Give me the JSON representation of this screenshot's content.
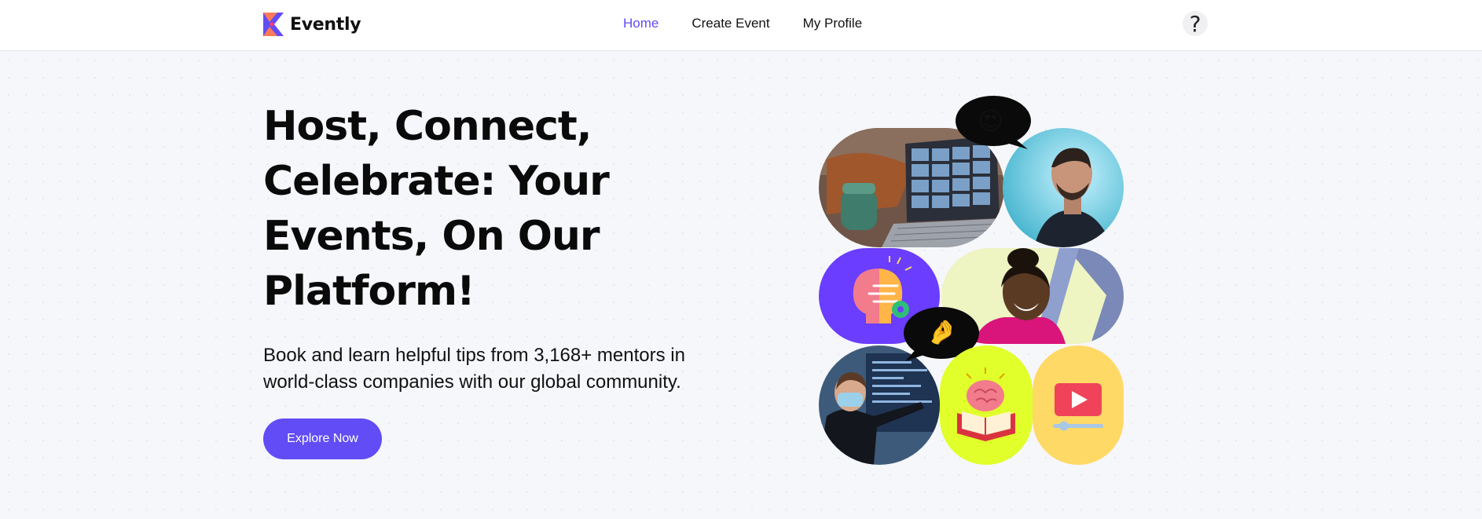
{
  "app": {
    "name": "Evently"
  },
  "nav": {
    "items": [
      {
        "label": "Home",
        "active": true
      },
      {
        "label": "Create Event",
        "active": false
      },
      {
        "label": "My Profile",
        "active": false
      }
    ]
  },
  "help": {
    "icon": "question-mark-icon",
    "symbol": "?"
  },
  "hero": {
    "title": "Host, Connect, Celebrate: Your Events, On Our Platform!",
    "subtitle": "Book and learn helpful tips from 3,168+ mentors in world-class companies with our global community.",
    "cta_label": "Explore Now"
  },
  "collage": {
    "bubble_1_emoji": "😍",
    "bubble_2_emoji": "🤌"
  },
  "colors": {
    "accent": "#624cf5",
    "tile_purple": "#6b3dff",
    "tile_lime": "#e1ff2a",
    "tile_yellow": "#ffd966"
  }
}
